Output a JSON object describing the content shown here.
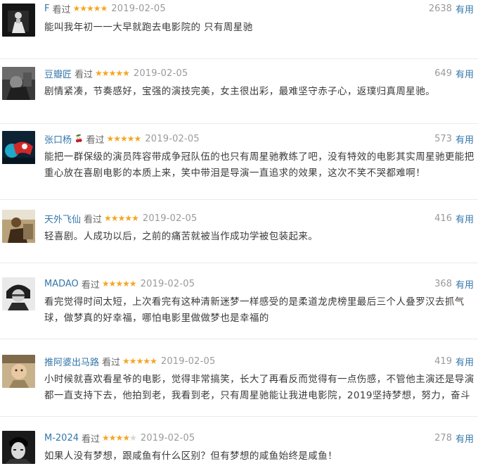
{
  "reviews": [
    {
      "author": "F",
      "badge": "",
      "status": "看过",
      "rating": 5,
      "date": "2019-02-05",
      "votes": "2638",
      "useful_label": "有用",
      "text": "能叫我年初一一大早就跑去电影院的 只有周星驰"
    },
    {
      "author": "豆瓣匠",
      "badge": "",
      "status": "看过",
      "rating": 5,
      "date": "2019-02-05",
      "votes": "649",
      "useful_label": "有用",
      "text": "剧情紧凑，节奏感好，宝强的演技完美，女主很出彩，最难坚守赤子心，返璞归真周星驰。"
    },
    {
      "author": "张口杨",
      "badge": "🍒",
      "status": "看过",
      "rating": 5,
      "date": "2019-02-05",
      "votes": "573",
      "useful_label": "有用",
      "text": "能把一群保级的演员阵容带成争冠队伍的也只有周星驰教练了吧，没有特效的电影其实周星驰更能把重心放在喜剧电影的本质上来，笑中带泪是导演一直追求的效果，这次不笑不哭都难啊！"
    },
    {
      "author": "天外飞仙",
      "badge": "",
      "status": "看过",
      "rating": 5,
      "date": "2019-02-05",
      "votes": "416",
      "useful_label": "有用",
      "text": "轻喜剧。人成功以后，之前的痛苦就被当作成功学被包装起来。"
    },
    {
      "author": "MADAO",
      "badge": "",
      "status": "看过",
      "rating": 5,
      "date": "2019-02-05",
      "votes": "368",
      "useful_label": "有用",
      "text": "看完觉得时间太短，上次看完有这种清新迷梦一样感受的是柔道龙虎榜里最后三个人叠罗汉去抓气球，做梦真的好幸福，哪怕电影里做做梦也是幸福的"
    },
    {
      "author": "推阿婆出马路",
      "badge": "",
      "status": "看过",
      "rating": 5,
      "date": "2019-02-05",
      "votes": "419",
      "useful_label": "有用",
      "text": "小时候就喜欢看星爷的电影，觉得非常搞笑，长大了再看反而觉得有一点伤感，不管他主演还是导演都一直支持下去，他拍到老，我看到老，只有周星驰能让我进电影院，2019坚持梦想，努力，奋斗"
    },
    {
      "author": "M-2024",
      "badge": "",
      "status": "看过",
      "rating": 4,
      "date": "2019-02-05",
      "votes": "278",
      "useful_label": "有用",
      "text": "如果人没有梦想，跟咸鱼有什么区别？但有梦想的咸鱼始终是咸鱼！"
    }
  ],
  "colors": {
    "link": "#3377aa",
    "star_on": "#f5a623",
    "star_off": "#d6d6d6",
    "meta_gray": "#9a9a9a"
  },
  "icons": {
    "star": "star-icon",
    "avatar": "avatar-photo"
  }
}
